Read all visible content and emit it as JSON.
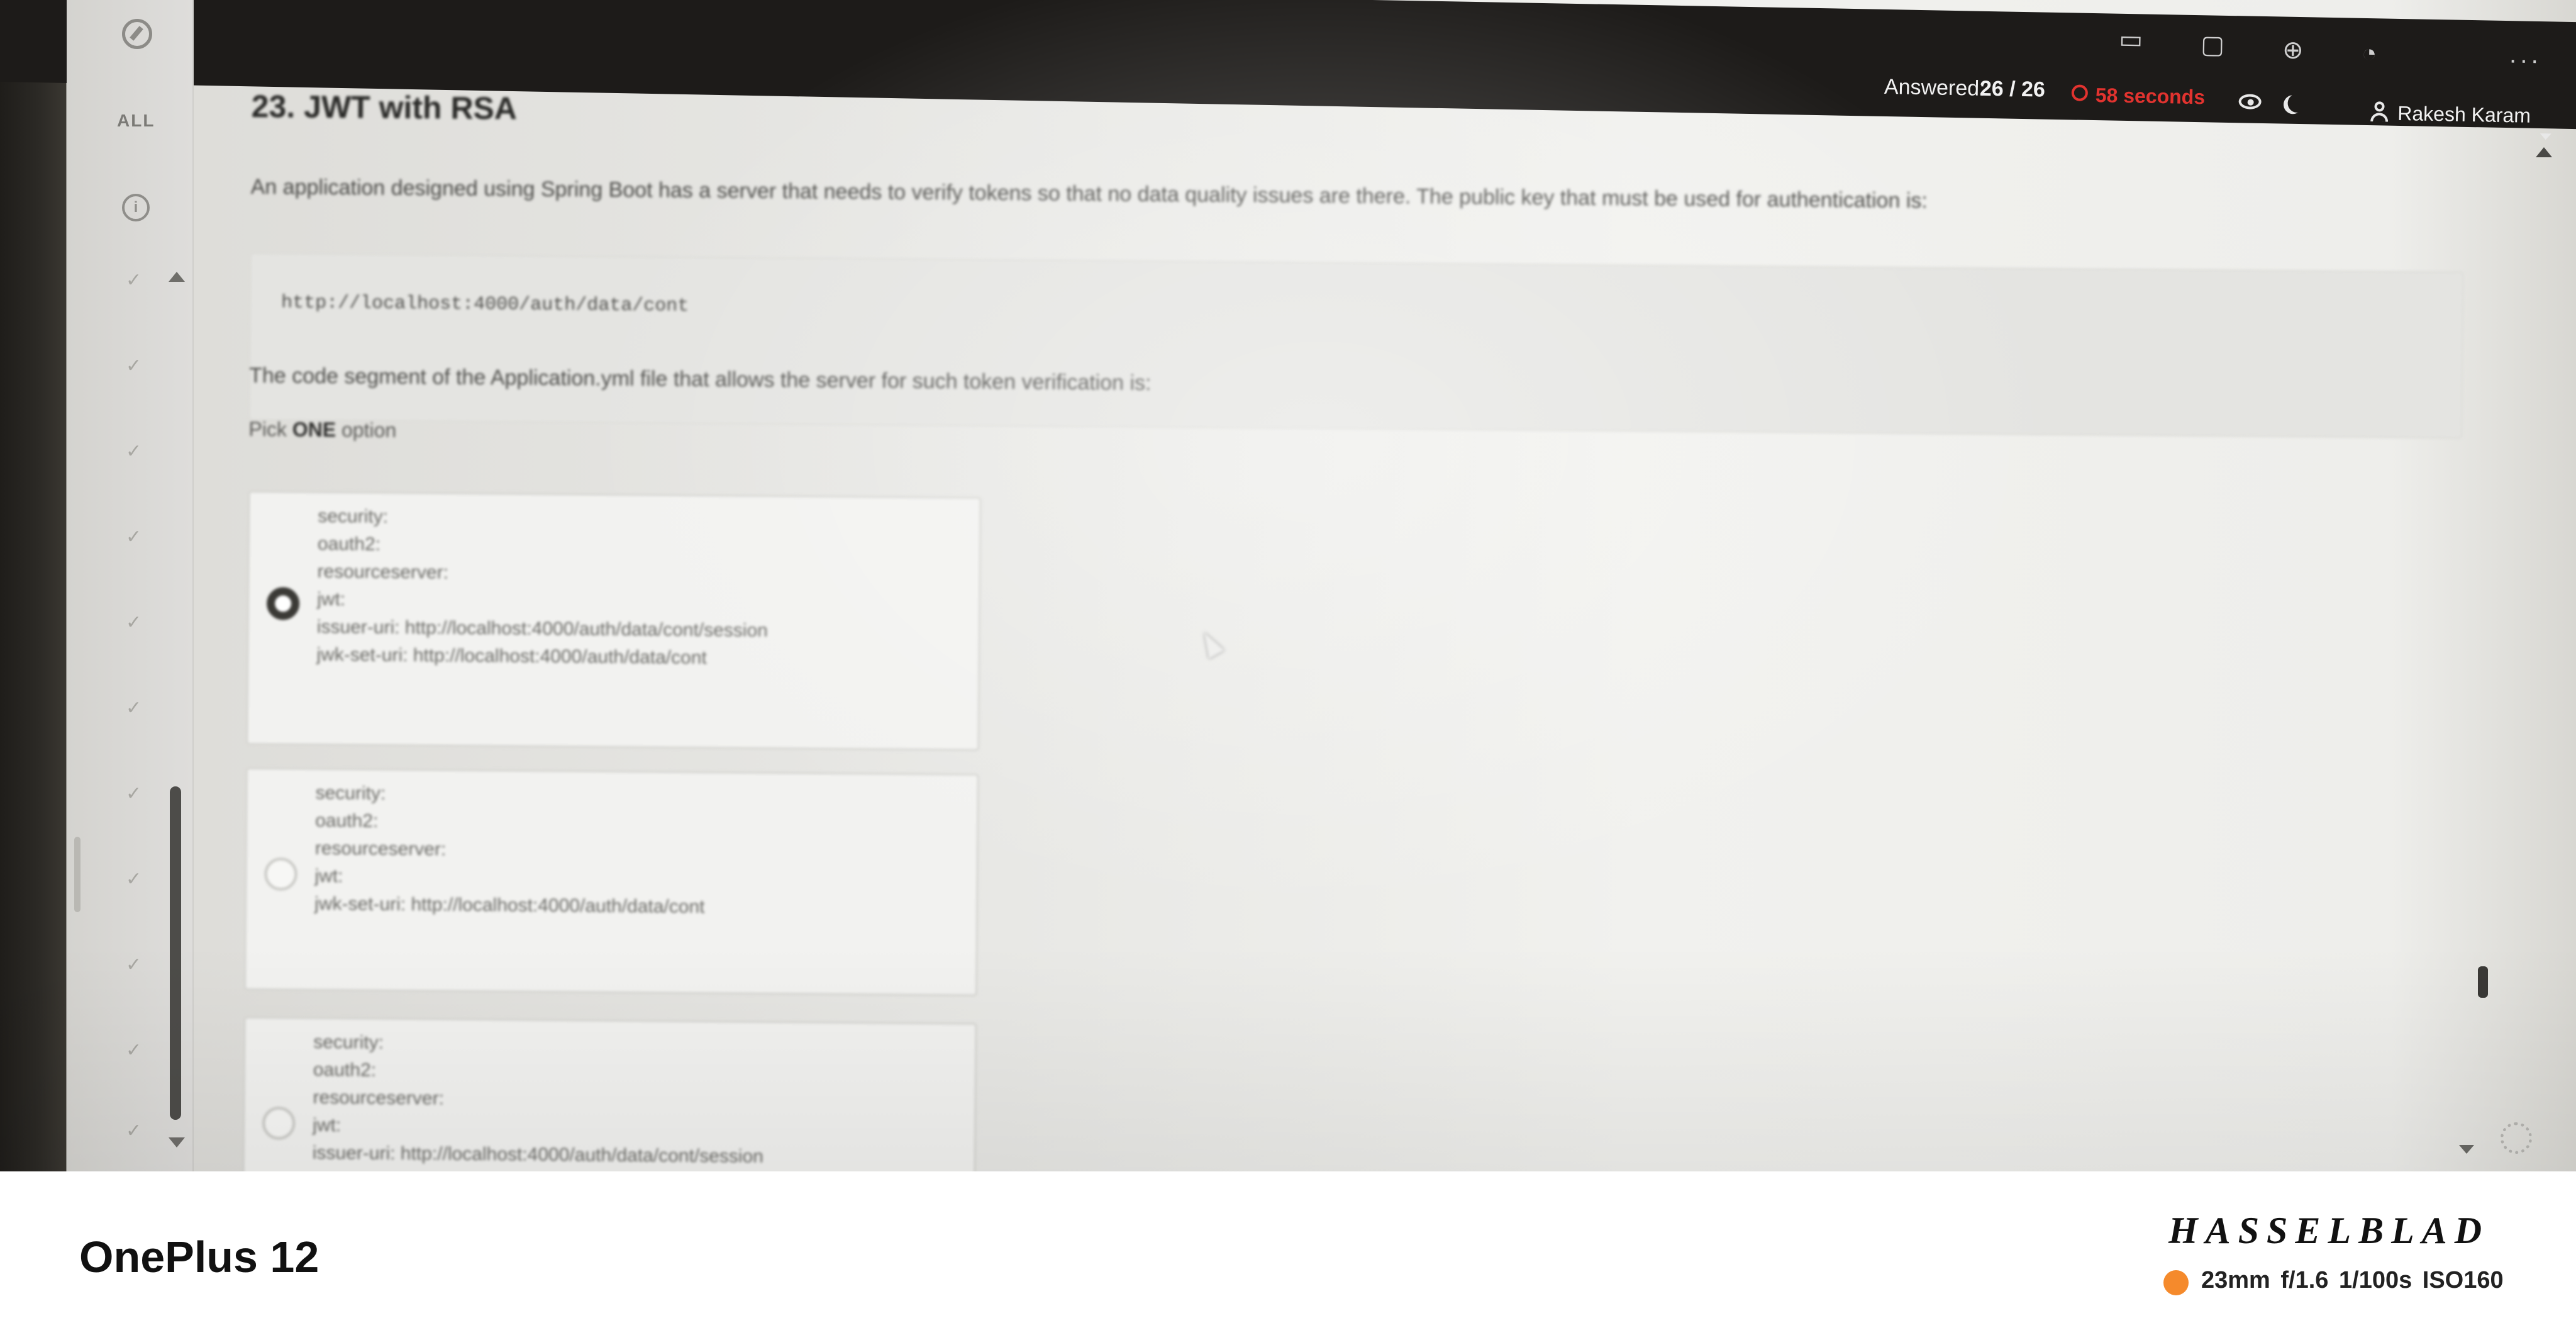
{
  "topbar": {
    "answered_label": "Answered:",
    "answered_value": "26 / 26",
    "timer_text": "58 seconds",
    "user_name": "Rakesh Karam",
    "timer_color": "#e2332f",
    "icons": [
      "timer-icon",
      "eye-icon",
      "moon-icon",
      "user-icon"
    ]
  },
  "sidebar": {
    "all_label": "ALL",
    "icons": [
      "compass-icon",
      "info-icon",
      "check-icon"
    ]
  },
  "question": {
    "title": "23. JWT with RSA",
    "text": "An application designed using Spring Boot has a server that needs to verify tokens so that no data quality issues are there. The public key that must be used for authentication is:",
    "code": "http://localhost:4000/auth/data/cont",
    "caption": "The code segment of the Application.yml file that allows the server for such token verification is:",
    "pick_prefix": "Pick",
    "pick_strong": "ONE",
    "pick_suffix": "option"
  },
  "options": [
    {
      "selected": true,
      "lines": [
        "security:",
        "oauth2:",
        "resourceserver:",
        "jwt:",
        "issuer-uri: http://localhost:4000/auth/data/cont/session",
        "jwk-set-uri: http://localhost:4000/auth/data/cont"
      ]
    },
    {
      "selected": false,
      "lines": [
        "security:",
        "oauth2:",
        "resourceserver:",
        "jwt:",
        "jwk-set-uri: http://localhost:4000/auth/data/cont"
      ]
    },
    {
      "selected": false,
      "lines": [
        "security:",
        "oauth2:",
        "resourceserver:",
        "jwt:",
        "issuer-uri: http://localhost:4000/auth/data/cont/session"
      ]
    }
  ],
  "footer": {
    "phone_model": "OnePlus 12",
    "brand": "HASSELBLAD",
    "exif": "23mm f/1.6 1/100s ISO160",
    "dot_color": "#f58a2c"
  }
}
